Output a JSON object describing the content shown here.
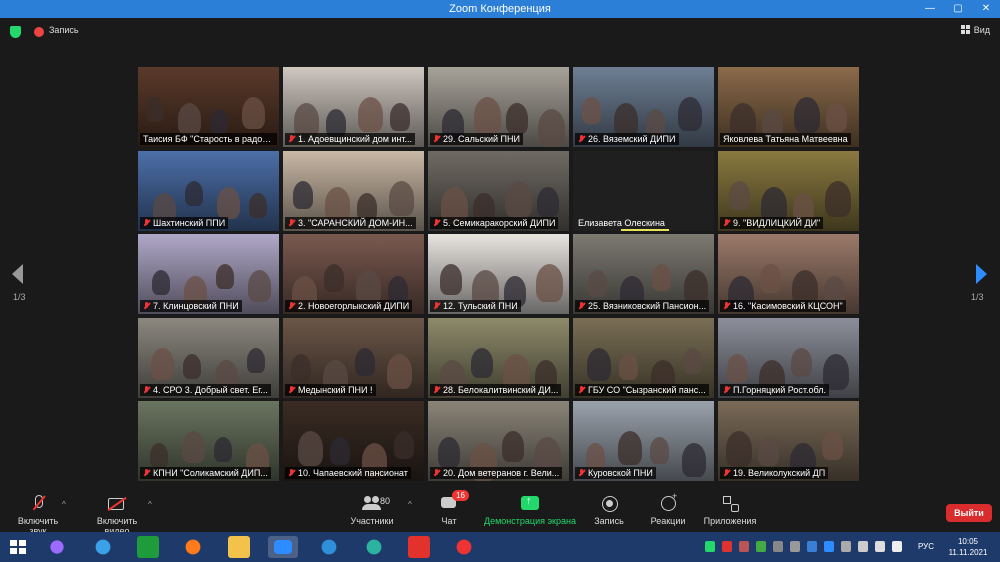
{
  "window": {
    "title": "Zoom Конференция"
  },
  "top": {
    "record_label": "Запись",
    "view_label": "Вид"
  },
  "tiles": [
    {
      "label": "Таисия БФ \"Старость в радос...",
      "muted": false,
      "active": true,
      "bg": "#5a3a2a"
    },
    {
      "label": "1. Адоевщинский дом инт...",
      "muted": true,
      "bg": "#cfc7c0"
    },
    {
      "label": "29. Сальский  ПНИ",
      "muted": true,
      "bg": "#a8a39a"
    },
    {
      "label": "26. Вяземский ДИПИ",
      "muted": true,
      "bg": "#6e7f95"
    },
    {
      "label": "Яковлева Татьяна Матвеевна",
      "muted": false,
      "bg": "#8a6a4a"
    },
    {
      "label": "Шахтинский ППИ",
      "muted": true,
      "bg": "#4c6fa8"
    },
    {
      "label": "3.  \"САРАНСКИЙ ДОМ-ИН...",
      "muted": true,
      "bg": "#c9b8a5"
    },
    {
      "label": "5. Семикаракорский ДИПИ",
      "muted": true,
      "bg": "#6f6a63"
    },
    {
      "label": "Елизавета Олескина",
      "muted": false,
      "blank": true,
      "speaker": true
    },
    {
      "label": "9. \"ВИДЛИЦКИЙ ДИ\"",
      "muted": true,
      "bg": "#8a7a40"
    },
    {
      "label": "7. Клинцовский ПНИ",
      "muted": true,
      "bg": "#b0a8c8"
    },
    {
      "label": "2. Новоегорлыкский ДИПИ",
      "muted": true,
      "bg": "#7a5a50"
    },
    {
      "label": "12. Тульский ПНИ",
      "muted": true,
      "bg": "#e8e4e0"
    },
    {
      "label": "25. Вязниковский Пансион...",
      "muted": true,
      "bg": "#7d7a72"
    },
    {
      "label": "16. \"Касимовский КЦСОН\"",
      "muted": true,
      "bg": "#9b7a6a"
    },
    {
      "label": "4. СРО 3. Добрый свет. Ег...",
      "muted": true,
      "bg": "#8c8880"
    },
    {
      "label": "Медынский ПНИ !",
      "muted": true,
      "bg": "#6b5648"
    },
    {
      "label": "28. Белокалитвинский ДИ...",
      "muted": true,
      "bg": "#8d8a6a"
    },
    {
      "label": "ГБУ СО \"Сызранский панс...",
      "muted": true,
      "bg": "#7a6f55"
    },
    {
      "label": "П.Горняцкий Рост.обл.",
      "muted": true,
      "bg": "#8c8f9a"
    },
    {
      "label": "КПНИ \"Соликамский ДИП...",
      "muted": true,
      "bg": "#6a7560"
    },
    {
      "label": "10. Чапаевский пансионат",
      "muted": true,
      "bg": "#3a2c24"
    },
    {
      "label": "20. Дом ветеранов г. Вели...",
      "muted": true,
      "bg": "#8a8478"
    },
    {
      "label": "Куровской ПНИ",
      "muted": true,
      "bg": "#9aa2ac"
    },
    {
      "label": "19. Великолукский ДП",
      "muted": true,
      "bg": "#7a6a58"
    }
  ],
  "pagination": {
    "left": "1/3",
    "right": "1/3"
  },
  "toolbar": {
    "mic_label": "Включить звук",
    "video_label": "Включить видео",
    "participants_label": "Участники",
    "participants_count": "80",
    "chat_label": "Чат",
    "chat_badge": "16",
    "share_label": "Демонстрация экрана",
    "record_label": "Запись",
    "reactions_label": "Реакции",
    "apps_label": "Приложения",
    "leave_label": "Выйти"
  },
  "taskbar": {
    "lang": "РУС",
    "time": "10:05",
    "date": "11.11.2021"
  },
  "colors": {
    "accent": "#2d8cff",
    "share": "#23d96c",
    "leave": "#d92c2c",
    "active_speaker": "#e6e35a"
  }
}
